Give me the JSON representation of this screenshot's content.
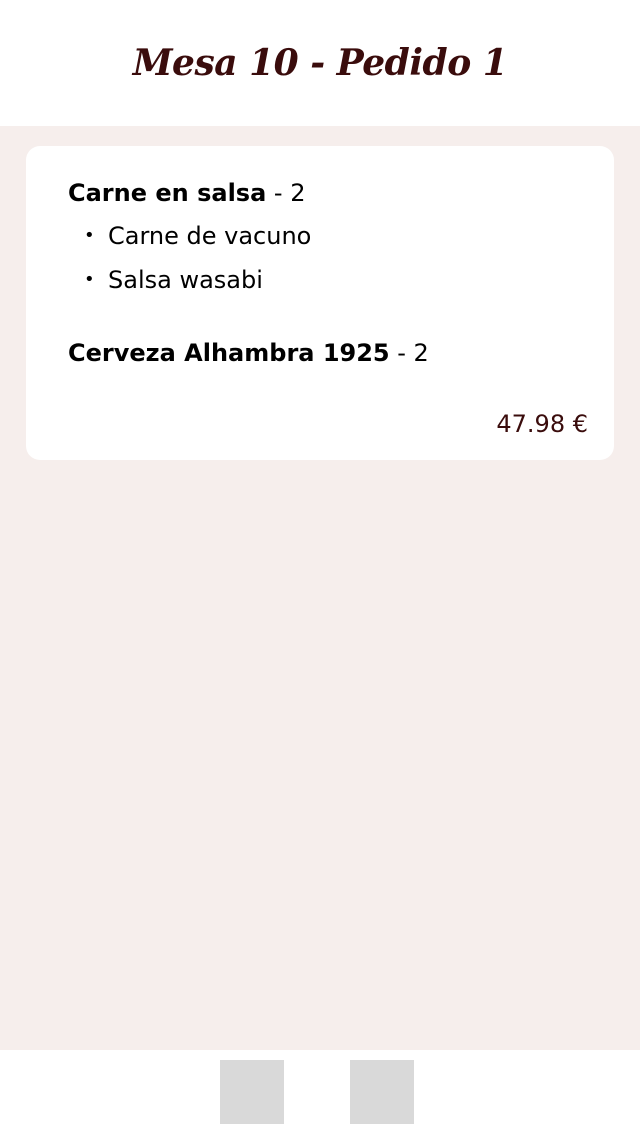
{
  "header": {
    "title": "Mesa 10 - Pedido 1"
  },
  "order": {
    "items": [
      {
        "name": "Carne en salsa",
        "separator": " - ",
        "quantity": "2",
        "extras": [
          "Carne de vacuno",
          "Salsa wasabi"
        ]
      },
      {
        "name": "Cerveza Alhambra 1925",
        "separator": " - ",
        "quantity": "2",
        "extras": []
      }
    ],
    "total": "47.98 €"
  },
  "colors": {
    "accent": "#3a0c0c",
    "background": "#f6eeec",
    "card": "#ffffff",
    "button_placeholder": "#d9d9d9"
  },
  "footer": {
    "buttons": [
      "placeholder-icon",
      "placeholder-icon"
    ]
  }
}
